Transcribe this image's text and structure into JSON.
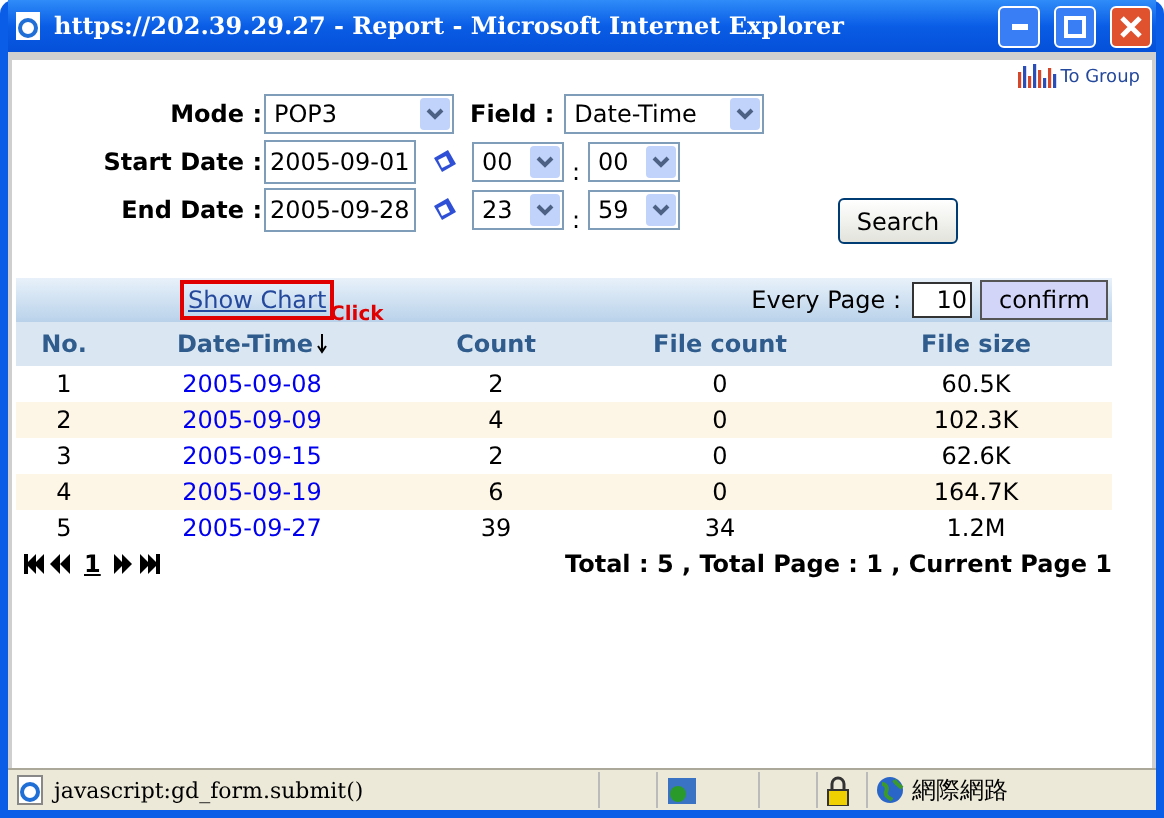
{
  "window": {
    "title": "https://202.39.29.27 - Report - Microsoft Internet Explorer"
  },
  "to_group": {
    "label": "To Group"
  },
  "form": {
    "mode": {
      "label": "Mode :",
      "value": "POP3"
    },
    "field": {
      "label": "Field :",
      "value": "Date-Time"
    },
    "start_date": {
      "label": "Start Date :",
      "value": "2005-09-01",
      "hour": "00",
      "minute": "00",
      "separator": ":"
    },
    "end_date": {
      "label": "End Date :",
      "value": "2005-09-28",
      "hour": "23",
      "minute": "59",
      "separator": ":"
    },
    "search_button": "Search"
  },
  "toolbar": {
    "show_chart": {
      "label": "Show Chart",
      "highlighted": true
    },
    "click_hint": "Click",
    "every_page_label": "Every Page :",
    "every_page_value": "10",
    "confirm_button": "confirm"
  },
  "table": {
    "columns": [
      {
        "label": "No.",
        "sorted": false
      },
      {
        "label": "Date-Time",
        "sorted": true
      },
      {
        "label": "Count",
        "sorted": false
      },
      {
        "label": "File count",
        "sorted": false
      },
      {
        "label": "File size",
        "sorted": false
      }
    ],
    "rows": [
      [
        "1",
        "2005-09-08",
        "2",
        "0",
        "60.5K"
      ],
      [
        "2",
        "2005-09-09",
        "4",
        "0",
        "102.3K"
      ],
      [
        "3",
        "2005-09-15",
        "2",
        "0",
        "62.6K"
      ],
      [
        "4",
        "2005-09-19",
        "6",
        "0",
        "164.7K"
      ],
      [
        "5",
        "2005-09-27",
        "39",
        "34",
        "1.2M"
      ]
    ]
  },
  "pagination": {
    "current_page": "1",
    "summary": "Total : 5 , Total Page : 1 , Current Page 1"
  },
  "status_bar": {
    "text": "javascript:gd_form.submit()",
    "zone": "網際網路"
  }
}
